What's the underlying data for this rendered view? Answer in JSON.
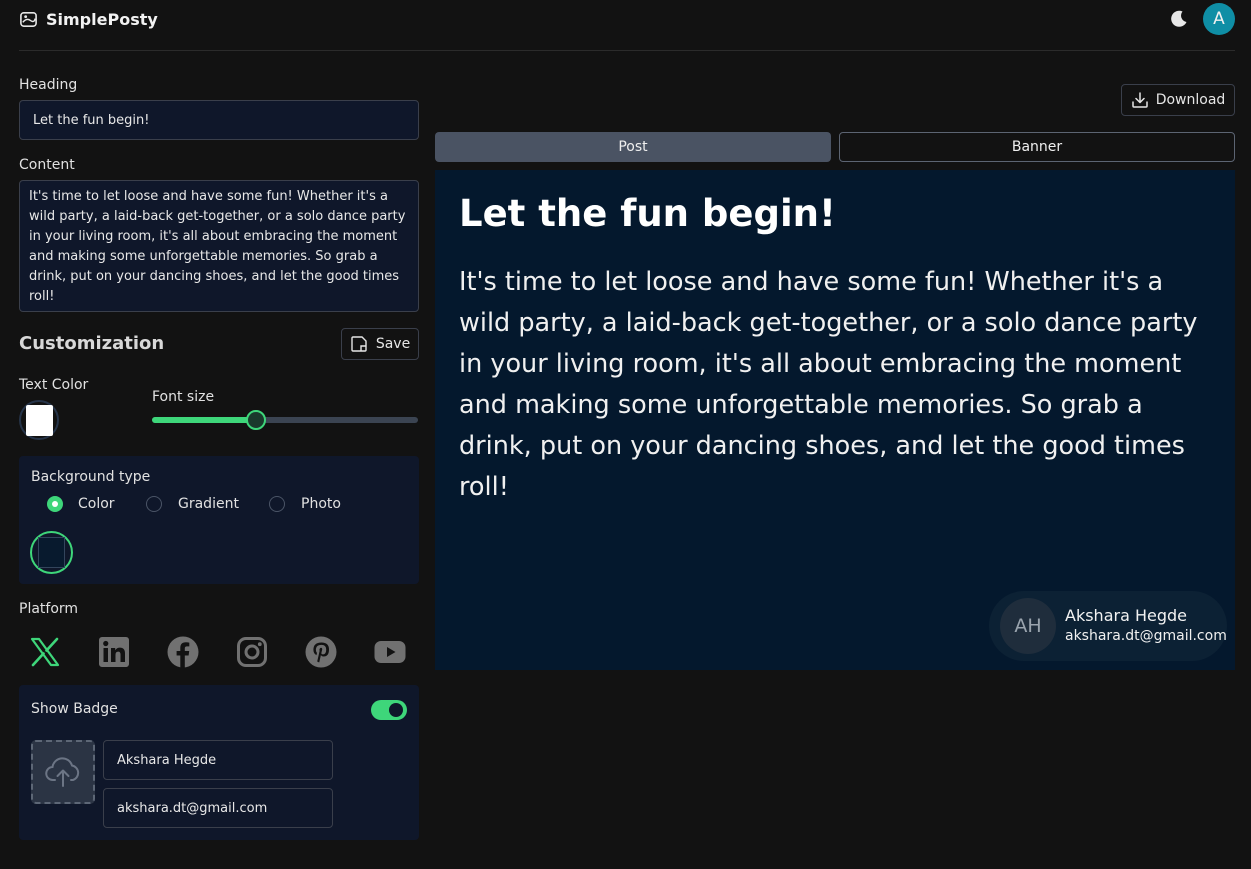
{
  "header": {
    "app_title": "SimplePosty",
    "avatar_initial": "A",
    "theme_icon": "moon-icon"
  },
  "editor": {
    "heading_label": "Heading",
    "heading_value": "Let the fun begin!",
    "content_label": "Content",
    "content_value": "It's time to let loose and have some fun! Whether it's a wild party, a laid-back get-together, or a solo dance party in your living room, it's all about embracing the moment and making some unforgettable memories. So grab a drink, put on your dancing shoes, and let the good times roll!"
  },
  "customization": {
    "title": "Customization",
    "save_label": "Save",
    "text_color_label": "Text Color",
    "text_color": "#ffffff",
    "font_size_label": "Font size",
    "font_size_fraction": 0.39,
    "background_type_label": "Background type",
    "background_options": [
      "Color",
      "Gradient",
      "Photo"
    ],
    "background_selected": "Color",
    "background_color": "#081a2e",
    "platform_label": "Platform",
    "platforms": [
      "x",
      "linkedin",
      "facebook",
      "instagram",
      "pinterest",
      "youtube"
    ],
    "platform_selected": "x",
    "show_badge_label": "Show Badge",
    "show_badge": true,
    "badge_name_value": "Akshara Hegde",
    "badge_email_value": "akshara.dt@gmail.com",
    "upload_icon": "cloud-upload-icon"
  },
  "preview_panel": {
    "download_label": "Download",
    "tabs": [
      "Post",
      "Banner"
    ],
    "active_tab": "Post",
    "heading": "Let the fun begin!",
    "body": "It's time to let loose and have some fun! Whether it's a wild party, a laid-back get-together, or a solo dance party in your living room, it's all about embracing the moment and making some unforgettable memories. So grab a drink, put on your dancing shoes, and let the good times roll!",
    "badge": {
      "initials": "AH",
      "name": "Akshara Hegde",
      "email": "akshara.dt@gmail.com"
    }
  },
  "colors": {
    "accent": "#3ed67a",
    "avatar": "#0f8ea5",
    "panel": "#0f172a",
    "preview_bg": "#04182d"
  }
}
